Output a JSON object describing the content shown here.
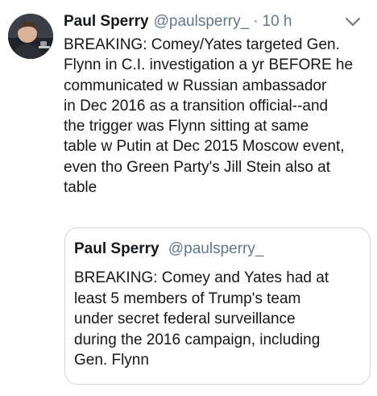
{
  "tweet": {
    "author_name": "Paul Sperry",
    "author_handle": "@paulsperry_",
    "separator": "·",
    "time": "10 h",
    "body_lines": [
      "BREAKING: Comey/Yates targeted Gen.",
      "Flynn in C.I. investigation a yr BEFORE he",
      "communicated w Russian ambassador",
      "in Dec 2016 as a transition official--and",
      "the trigger was Flynn sitting at same",
      "table w Putin at Dec 2015 Moscow event,",
      "even tho Green Party's Jill Stein also at",
      "table"
    ],
    "menu_icon": "chevron-down-icon"
  },
  "quoted_tweet": {
    "author_name": "Paul Sperry",
    "author_handle": "@paulsperry_",
    "body_lines": [
      "BREAKING: Comey and Yates had at",
      "least 5 members of Trump's team",
      "under secret federal surveillance",
      "during the 2016 campaign, including",
      "Gen. Flynn"
    ]
  },
  "colors": {
    "text": "#14171a",
    "secondary": "#657786",
    "border": "#ccd6dd"
  }
}
